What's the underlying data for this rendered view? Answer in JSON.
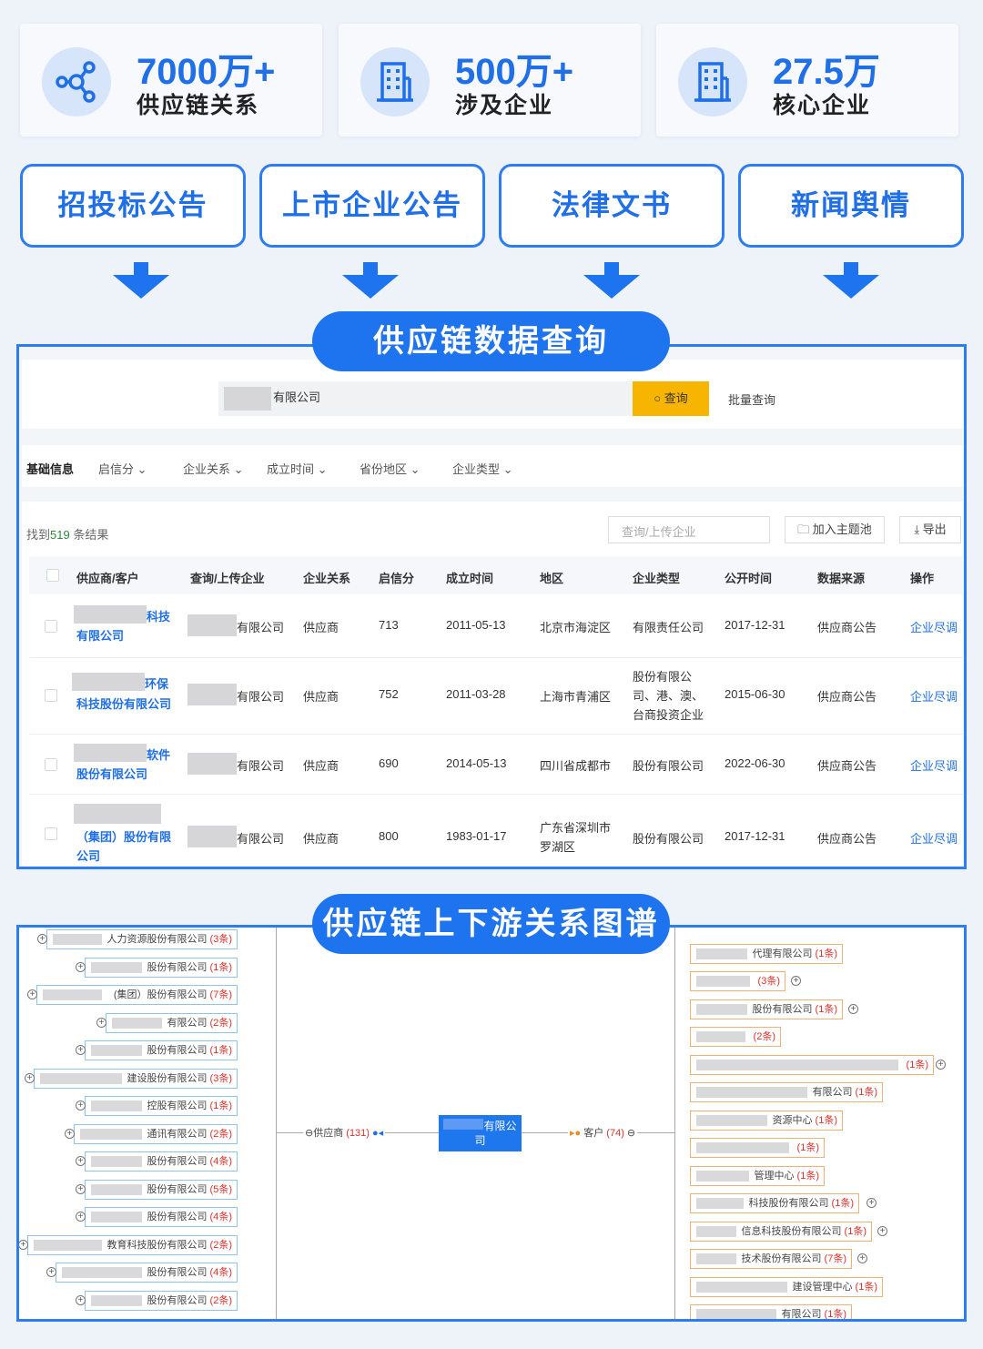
{
  "stats": [
    {
      "number": "7000万+",
      "label": "供应链关系",
      "icon": "network-icon"
    },
    {
      "number": "500万+",
      "label": "涉及企业",
      "icon": "building-icon"
    },
    {
      "number": "27.5万",
      "label": "核心企业",
      "icon": "building-icon"
    }
  ],
  "sources": [
    "招投标公告",
    "上市企业公告",
    "法律文书",
    "新闻舆情"
  ],
  "query_title": "供应链数据查询",
  "search": {
    "value": "有限公司",
    "button": "查询",
    "batch": "批量查询"
  },
  "filters": {
    "base": "基础信息",
    "items": [
      "启信分",
      "企业关系",
      "成立时间",
      "省份地区",
      "企业类型"
    ]
  },
  "results": {
    "prefix": "找到",
    "count": "519",
    "suffix": "条结果",
    "query_placeholder": "查询/上传企业",
    "add_topic": "加入主题池",
    "export": "导出"
  },
  "table": {
    "headers": [
      "供应商/客户",
      "查询/上传企业",
      "企业关系",
      "启信分",
      "成立时间",
      "地区",
      "企业类型",
      "公开时间",
      "数据来源",
      "操作"
    ],
    "rows": [
      {
        "name_tail": "科技",
        "name_line2": "有限公司",
        "query": "有限公司",
        "relation": "供应商",
        "score": "713",
        "founded": "2011-05-13",
        "region": "北京市海淀区",
        "type": "有限责任公司",
        "published": "2017-12-31",
        "source": "供应商公告",
        "action": "企业尽调"
      },
      {
        "name_tail": "环保",
        "name_line2": "科技股份有限公司",
        "query": "有限公司",
        "relation": "供应商",
        "score": "752",
        "founded": "2011-03-28",
        "region": "上海市青浦区",
        "type": "股份有限公司、港、澳、台商投资企业",
        "published": "2015-06-30",
        "source": "供应商公告",
        "action": "企业尽调"
      },
      {
        "name_tail": "软件",
        "name_line2": "股份有限公司",
        "query": "有限公司",
        "relation": "供应商",
        "score": "690",
        "founded": "2014-05-13",
        "region": "四川省成都市",
        "type": "股份有限公司",
        "published": "2022-06-30",
        "source": "供应商公告",
        "action": "企业尽调"
      },
      {
        "name_tail": "（集团）股份有限",
        "name_line2": "公司",
        "query": "有限公司",
        "relation": "供应商",
        "score": "800",
        "founded": "1983-01-17",
        "region": "广东省深圳市罗湖区",
        "type": "股份有限公司",
        "published": "2017-12-31",
        "source": "供应商公告",
        "action": "企业尽调"
      }
    ]
  },
  "graph_title": "供应链上下游关系图谱",
  "graph": {
    "center": "有限公司",
    "supplier_label": "供应商",
    "supplier_count": "(131)",
    "customer_label": "客户",
    "customer_count": "(74)",
    "left_nodes": [
      {
        "text": "人力资源股份有限公司",
        "count": "(3条)"
      },
      {
        "text": "股份有限公司",
        "count": "(1条)"
      },
      {
        "text": "(集团）股份有限公司",
        "count": "(7条)"
      },
      {
        "text": "有限公司",
        "count": "(2条)"
      },
      {
        "text": "股份有限公司",
        "count": "(1条)"
      },
      {
        "text": "建设股份有限公司",
        "count": "(3条)"
      },
      {
        "text": "控股有限公司",
        "count": "(1条)"
      },
      {
        "text": "通讯有限公司",
        "count": "(2条)"
      },
      {
        "text": "股份有限公司",
        "count": "(4条)"
      },
      {
        "text": "股份有限公司",
        "count": "(5条)"
      },
      {
        "text": "股份有限公司",
        "count": "(4条)"
      },
      {
        "text": "教育科技股份有限公司",
        "count": "(2条)"
      },
      {
        "text": "股份有限公司",
        "count": "(4条)"
      },
      {
        "text": "股份有限公司",
        "count": "(2条)"
      }
    ],
    "right_nodes": [
      {
        "text": "代理有限公司",
        "count": "(1条)"
      },
      {
        "text": "",
        "count": "(3条)"
      },
      {
        "text": "股份有限公司",
        "count": "(1条)"
      },
      {
        "text": "",
        "count": "(2条)"
      },
      {
        "text": "",
        "count": "(1条)"
      },
      {
        "text": "有限公司",
        "count": "(1条)"
      },
      {
        "text": "资源中心",
        "count": "(1条)"
      },
      {
        "text": "",
        "count": "(1条)"
      },
      {
        "text": "管理中心",
        "count": "(1条)"
      },
      {
        "text": "科技股份有限公司",
        "count": "(1条)"
      },
      {
        "text": "信息科技股份有限公司",
        "count": "(1条)"
      },
      {
        "text": "技术股份有限公司",
        "count": "(7条)"
      },
      {
        "text": "建设管理中心",
        "count": "(1条)"
      },
      {
        "text": "有限公司",
        "count": "(1条)"
      }
    ]
  }
}
